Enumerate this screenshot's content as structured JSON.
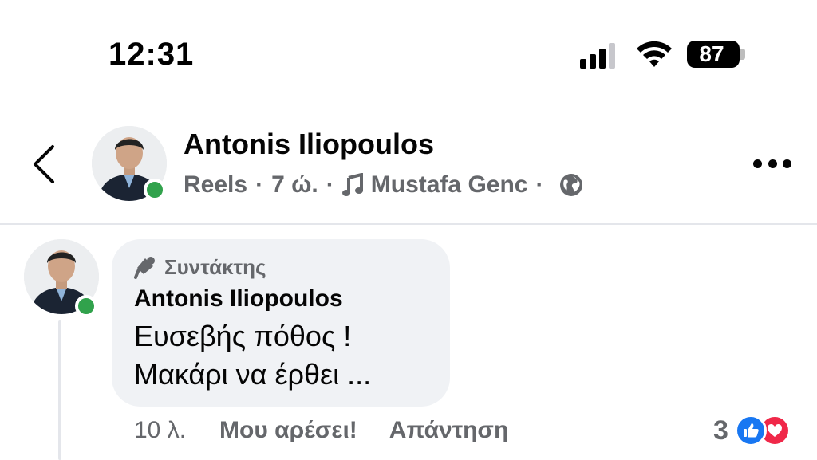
{
  "status_bar": {
    "time": "12:31",
    "battery": "87",
    "signal_bars_active": 3,
    "signal_bars_total": 4
  },
  "header": {
    "back_icon": "chevron-left-icon",
    "author_name": "Antonis Iliopoulos",
    "meta": {
      "type": "Reels",
      "separator": "·",
      "time": "7 ώ.",
      "music_icon": "music-note-icon",
      "music": "Mustafa Genc",
      "audience_icon": "globe-icon"
    },
    "more_icon": "more-horizontal-icon"
  },
  "comment": {
    "badge_icon": "microphone-icon",
    "badge": "Συντάκτης",
    "author": "Antonis Iliopoulos",
    "text_line_1": "Ευσεβής πόθος !",
    "text_line_2": "Μακάρι να έρθει ...",
    "time": "10 λ.",
    "like_label": "Μου αρέσει!",
    "reply_label": "Απάντηση",
    "reactions_count": "3",
    "reactions": [
      "like-reaction-icon",
      "love-reaction-icon"
    ]
  },
  "colors": {
    "online": "#31a24c",
    "like_blue": "#1877f2",
    "love_red": "#f02849",
    "secondary_text": "#65676b",
    "bubble_bg": "#f0f2f5"
  }
}
